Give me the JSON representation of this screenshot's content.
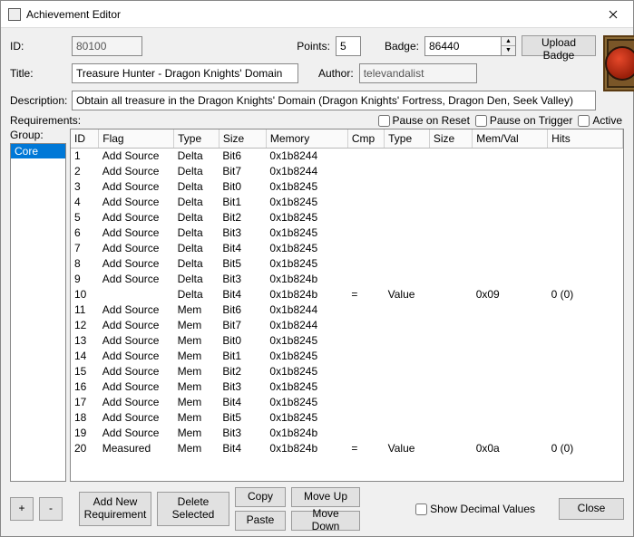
{
  "window": {
    "title": "Achievement Editor"
  },
  "labels": {
    "id": "ID:",
    "points": "Points:",
    "badge": "Badge:",
    "upload": "Upload Badge",
    "title": "Title:",
    "author": "Author:",
    "description": "Description:",
    "requirements": "Requirements:",
    "group": "Group:",
    "pause_reset": "Pause on Reset",
    "pause_trigger": "Pause on Trigger",
    "active": "Active",
    "add_new": "Add New Requirement",
    "delete_sel": "Delete Selected",
    "copy": "Copy",
    "paste": "Paste",
    "move_up": "Move Up",
    "move_down": "Move Down",
    "show_dec": "Show Decimal Values",
    "close": "Close",
    "plus": "+",
    "minus": "-"
  },
  "fields": {
    "id": "80100",
    "points": "5",
    "badge": "86440",
    "title": "Treasure Hunter - Dragon Knights' Domain",
    "author": "televandalist",
    "description": "Obtain all treasure in the Dragon Knights' Domain (Dragon Knights' Fortress, Dragon Den, Seek Valley)"
  },
  "checks": {
    "pause_reset": false,
    "pause_trigger": false,
    "active": false,
    "show_dec": false
  },
  "group_items": [
    "Core"
  ],
  "grid_headers": [
    "ID",
    "Flag",
    "Type",
    "Size",
    "Memory",
    "Cmp",
    "Type",
    "Size",
    "Mem/Val",
    "Hits"
  ],
  "rows": [
    {
      "id": "1",
      "flag": "Add Source",
      "type": "Delta",
      "size": "Bit6",
      "mem": "0x1b8244",
      "cmp": "",
      "type2": "",
      "size2": "",
      "memval": "",
      "hits": ""
    },
    {
      "id": "2",
      "flag": "Add Source",
      "type": "Delta",
      "size": "Bit7",
      "mem": "0x1b8244",
      "cmp": "",
      "type2": "",
      "size2": "",
      "memval": "",
      "hits": ""
    },
    {
      "id": "3",
      "flag": "Add Source",
      "type": "Delta",
      "size": "Bit0",
      "mem": "0x1b8245",
      "cmp": "",
      "type2": "",
      "size2": "",
      "memval": "",
      "hits": ""
    },
    {
      "id": "4",
      "flag": "Add Source",
      "type": "Delta",
      "size": "Bit1",
      "mem": "0x1b8245",
      "cmp": "",
      "type2": "",
      "size2": "",
      "memval": "",
      "hits": ""
    },
    {
      "id": "5",
      "flag": "Add Source",
      "type": "Delta",
      "size": "Bit2",
      "mem": "0x1b8245",
      "cmp": "",
      "type2": "",
      "size2": "",
      "memval": "",
      "hits": ""
    },
    {
      "id": "6",
      "flag": "Add Source",
      "type": "Delta",
      "size": "Bit3",
      "mem": "0x1b8245",
      "cmp": "",
      "type2": "",
      "size2": "",
      "memval": "",
      "hits": ""
    },
    {
      "id": "7",
      "flag": "Add Source",
      "type": "Delta",
      "size": "Bit4",
      "mem": "0x1b8245",
      "cmp": "",
      "type2": "",
      "size2": "",
      "memval": "",
      "hits": ""
    },
    {
      "id": "8",
      "flag": "Add Source",
      "type": "Delta",
      "size": "Bit5",
      "mem": "0x1b8245",
      "cmp": "",
      "type2": "",
      "size2": "",
      "memval": "",
      "hits": ""
    },
    {
      "id": "9",
      "flag": "Add Source",
      "type": "Delta",
      "size": "Bit3",
      "mem": "0x1b824b",
      "cmp": "",
      "type2": "",
      "size2": "",
      "memval": "",
      "hits": ""
    },
    {
      "id": "10",
      "flag": "",
      "type": "Delta",
      "size": "Bit4",
      "mem": "0x1b824b",
      "cmp": "=",
      "type2": "Value",
      "size2": "",
      "memval": "0x09",
      "hits": "0 (0)"
    },
    {
      "id": "11",
      "flag": "Add Source",
      "type": "Mem",
      "size": "Bit6",
      "mem": "0x1b8244",
      "cmp": "",
      "type2": "",
      "size2": "",
      "memval": "",
      "hits": ""
    },
    {
      "id": "12",
      "flag": "Add Source",
      "type": "Mem",
      "size": "Bit7",
      "mem": "0x1b8244",
      "cmp": "",
      "type2": "",
      "size2": "",
      "memval": "",
      "hits": ""
    },
    {
      "id": "13",
      "flag": "Add Source",
      "type": "Mem",
      "size": "Bit0",
      "mem": "0x1b8245",
      "cmp": "",
      "type2": "",
      "size2": "",
      "memval": "",
      "hits": ""
    },
    {
      "id": "14",
      "flag": "Add Source",
      "type": "Mem",
      "size": "Bit1",
      "mem": "0x1b8245",
      "cmp": "",
      "type2": "",
      "size2": "",
      "memval": "",
      "hits": ""
    },
    {
      "id": "15",
      "flag": "Add Source",
      "type": "Mem",
      "size": "Bit2",
      "mem": "0x1b8245",
      "cmp": "",
      "type2": "",
      "size2": "",
      "memval": "",
      "hits": ""
    },
    {
      "id": "16",
      "flag": "Add Source",
      "type": "Mem",
      "size": "Bit3",
      "mem": "0x1b8245",
      "cmp": "",
      "type2": "",
      "size2": "",
      "memval": "",
      "hits": ""
    },
    {
      "id": "17",
      "flag": "Add Source",
      "type": "Mem",
      "size": "Bit4",
      "mem": "0x1b8245",
      "cmp": "",
      "type2": "",
      "size2": "",
      "memval": "",
      "hits": ""
    },
    {
      "id": "18",
      "flag": "Add Source",
      "type": "Mem",
      "size": "Bit5",
      "mem": "0x1b8245",
      "cmp": "",
      "type2": "",
      "size2": "",
      "memval": "",
      "hits": ""
    },
    {
      "id": "19",
      "flag": "Add Source",
      "type": "Mem",
      "size": "Bit3",
      "mem": "0x1b824b",
      "cmp": "",
      "type2": "",
      "size2": "",
      "memval": "",
      "hits": ""
    },
    {
      "id": "20",
      "flag": "Measured",
      "type": "Mem",
      "size": "Bit4",
      "mem": "0x1b824b",
      "cmp": "=",
      "type2": "Value",
      "size2": "",
      "memval": "0x0a",
      "hits": "0 (0)"
    }
  ]
}
